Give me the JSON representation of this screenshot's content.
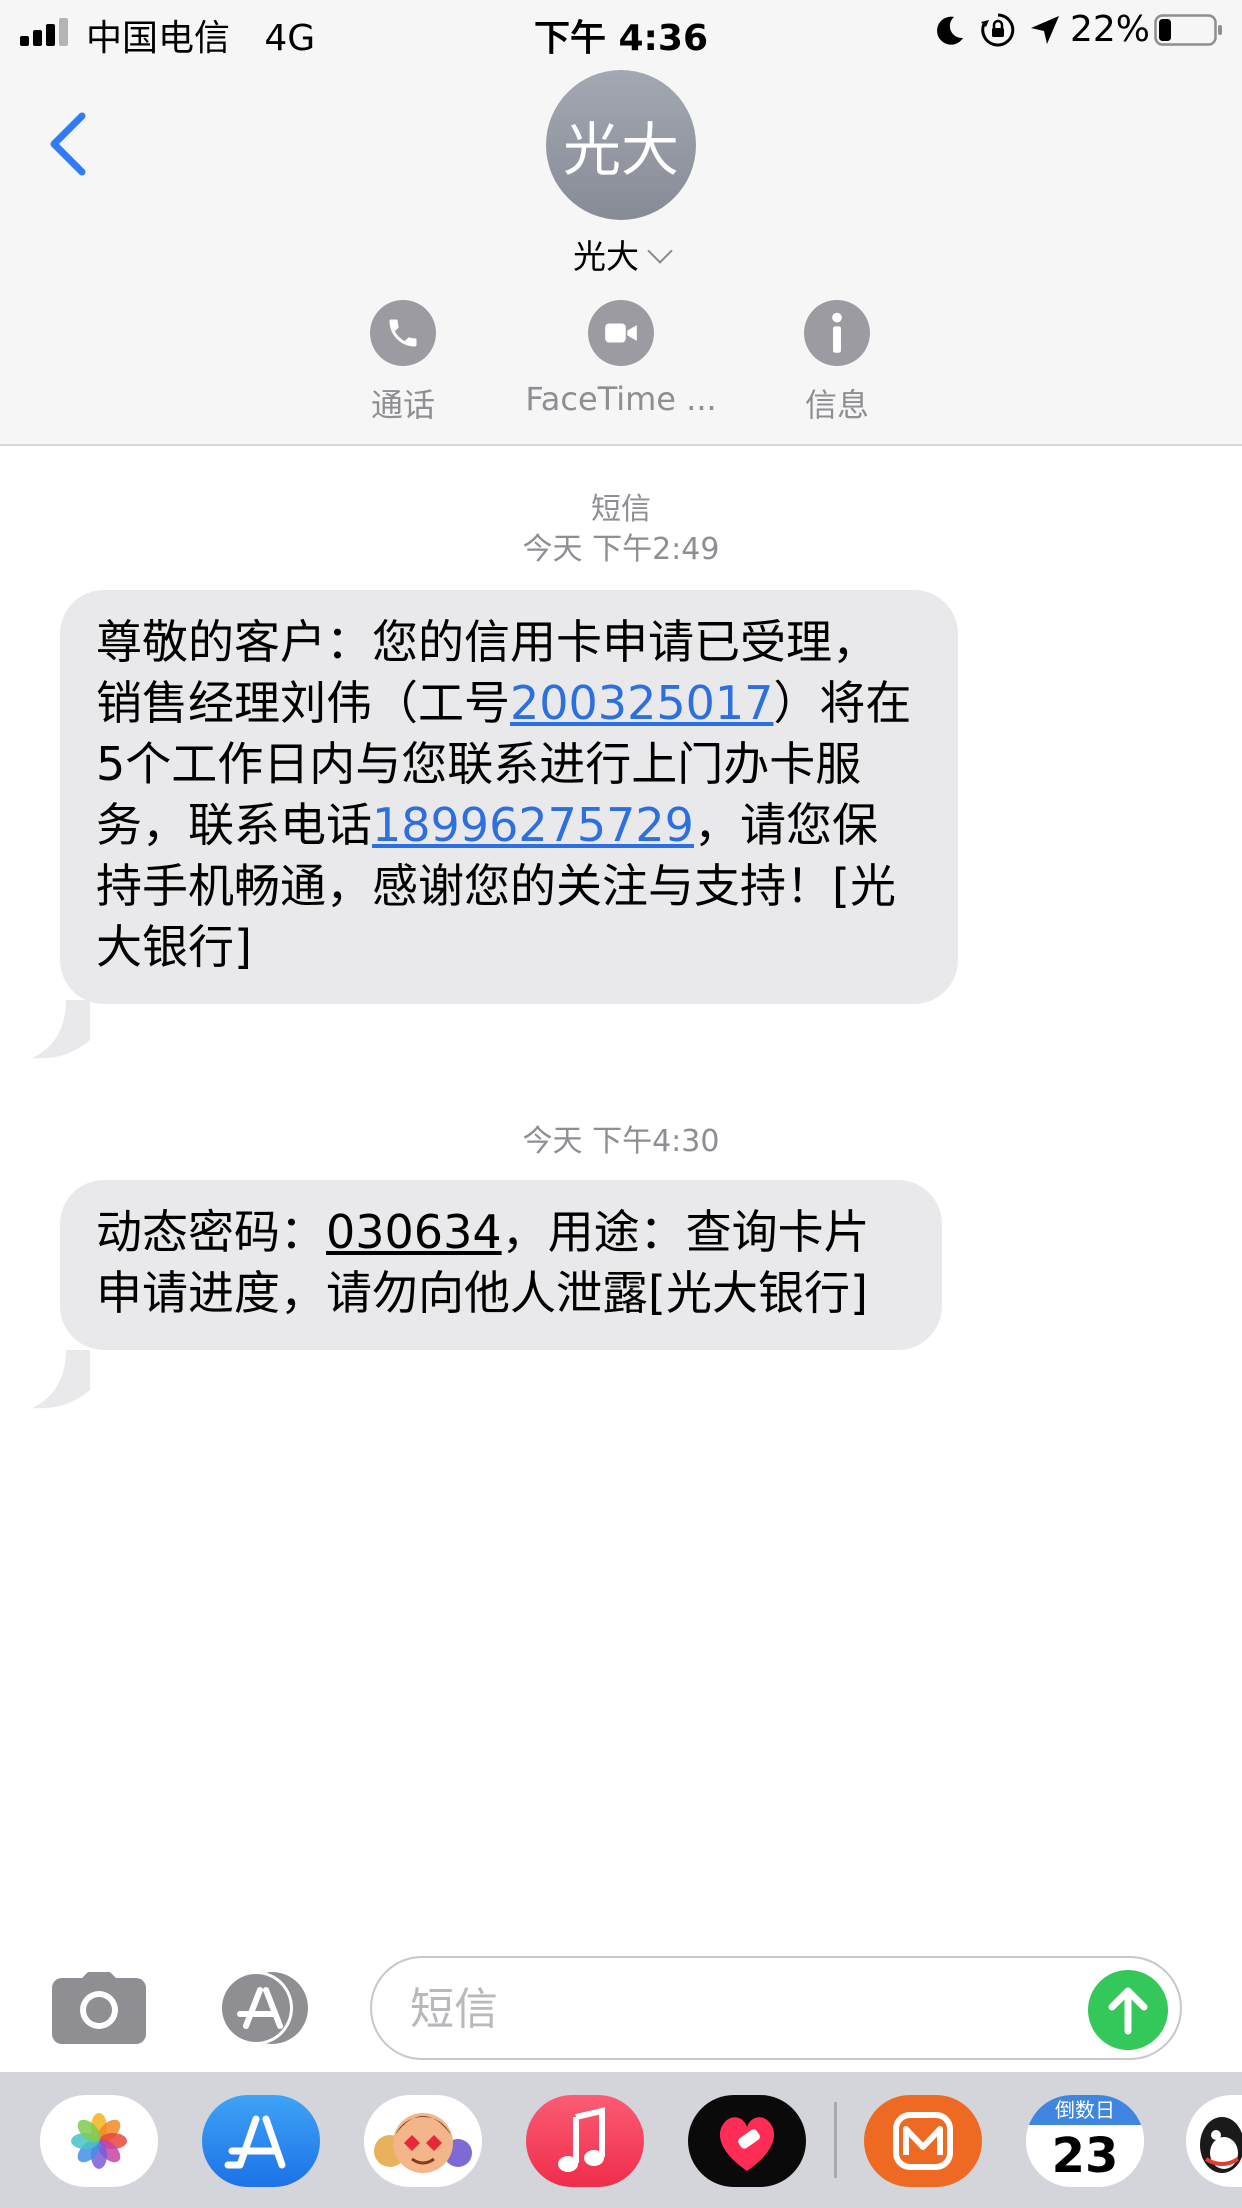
{
  "status_bar": {
    "carrier": "中国电信",
    "network": "4G",
    "time": "下午 4:36",
    "battery_percent": "22%",
    "battery_level": 0.22
  },
  "header": {
    "avatar_text": "光大",
    "contact_name": "光大",
    "actions": [
      {
        "label": "通话",
        "icon": "phone-icon"
      },
      {
        "label": "FaceTime ...",
        "icon": "video-camera-icon"
      },
      {
        "label": "信息",
        "icon": "info-icon"
      }
    ]
  },
  "conversation": {
    "service_label": "短信",
    "messages": [
      {
        "timestamp": "今天 下午2:49",
        "parts": [
          "尊敬的客户：您的信用卡申请已受理，销售经理刘伟（工号",
          "200325017",
          "）将在5个工作日内与您联系进行上门办卡服务，联系电话",
          "18996275729",
          "，请您保持手机畅通，感谢您的关注与支持！[光大银行]"
        ]
      },
      {
        "timestamp": "今天 下午4:30",
        "parts": [
          "动态密码：",
          "030634",
          "，用途：查询卡片申请进度，请勿向他人泄露[光大银行]"
        ]
      }
    ]
  },
  "composer": {
    "placeholder": "短信",
    "value": ""
  },
  "app_drawer": {
    "calendar_header": "倒数日",
    "calendar_number": "23",
    "apps": [
      "photos-icon",
      "app-store-icon",
      "memoji-icon",
      "music-icon",
      "heart-app-icon",
      "mango-tv-icon",
      "countdown-days-icon",
      "qq-icon"
    ]
  },
  "colors": {
    "link": "#2e6fe0",
    "bubble": "#e9e9eb",
    "send": "#34c759",
    "back": "#2f7cf6"
  }
}
